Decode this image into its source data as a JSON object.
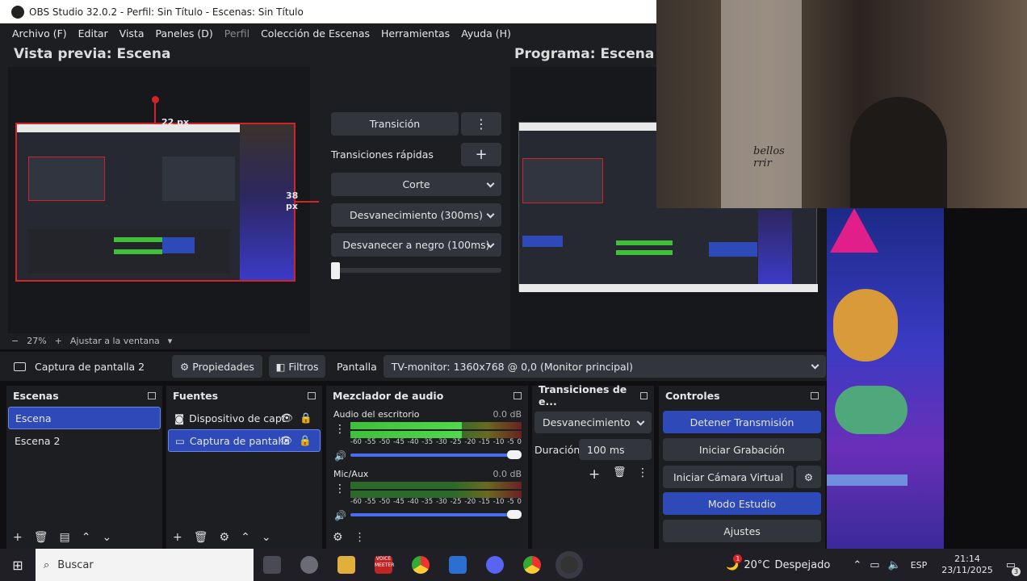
{
  "window": {
    "title": "OBS Studio 32.0.2 - Perfil: Sin Título - Escenas: Sin Título"
  },
  "menu": [
    "Archivo (F)",
    "Editar",
    "Vista",
    "Paneles (D)",
    "Perfil",
    "Colección de Escenas",
    "Herramientas",
    "Ayuda (H)"
  ],
  "preview": {
    "label": "Vista previa: Escena",
    "top_measure": "22 px",
    "right_measure": "38 px",
    "zoom": "27%",
    "fit_label": "Ajustar a la ventana"
  },
  "program": {
    "label": "Programa: Escena"
  },
  "transition_panel": {
    "transition_button": "Transición",
    "quick_label": "Transiciones rápidas",
    "quick_items": [
      "Corte",
      "Desvanecimiento (300ms)",
      "Desvanecer a negro (100ms)"
    ]
  },
  "source_bar": {
    "source_name": "Captura de pantalla 2",
    "properties": "Propiedades",
    "filters": "Filtros",
    "display_label": "Pantalla",
    "display_value": "TV-monitor: 1360x768 @ 0,0 (Monitor principal)"
  },
  "scenes": {
    "title": "Escenas",
    "items": [
      "Escena",
      "Escena 2"
    ]
  },
  "sources": {
    "title": "Fuentes",
    "items": [
      "Dispositivo de capt",
      "Captura de pantalla"
    ]
  },
  "mixer": {
    "title": "Mezclador de audio",
    "channels": [
      {
        "name": "Audio del escritorio",
        "db": "0.0 dB",
        "level": 0.65
      },
      {
        "name": "Mic/Aux",
        "db": "0.0 dB",
        "level": 0.0
      }
    ],
    "scale": [
      "-60",
      "-55",
      "-50",
      "-45",
      "-40",
      "-35",
      "-30",
      "-25",
      "-20",
      "-15",
      "-10",
      "-5",
      "0"
    ]
  },
  "transitions_dock": {
    "title": "Transiciones de e...",
    "selected": "Desvanecimiento",
    "duration_label": "Duración",
    "duration_value": "100 ms"
  },
  "controls": {
    "title": "Controles",
    "stream": "Detener Transmisión",
    "record": "Iniciar Grabación",
    "virtualcam": "Iniciar Cámara Virtual",
    "studio": "Modo Estudio",
    "settings": "Ajustes"
  },
  "webcam_text": "bellos\nrrir",
  "taskbar": {
    "search": "Buscar",
    "weather_temp": "20°C",
    "weather_text": "Despejado",
    "lang": "ESP",
    "time": "21:14",
    "date": "23/11/2025",
    "weather_badge": "1",
    "notify_count": "3",
    "meet_label": "VOICE\nMEETER"
  },
  "colors": {
    "accent": "#2e4ab8",
    "red_box": "#d0242a",
    "panel": "#1d1e22"
  }
}
